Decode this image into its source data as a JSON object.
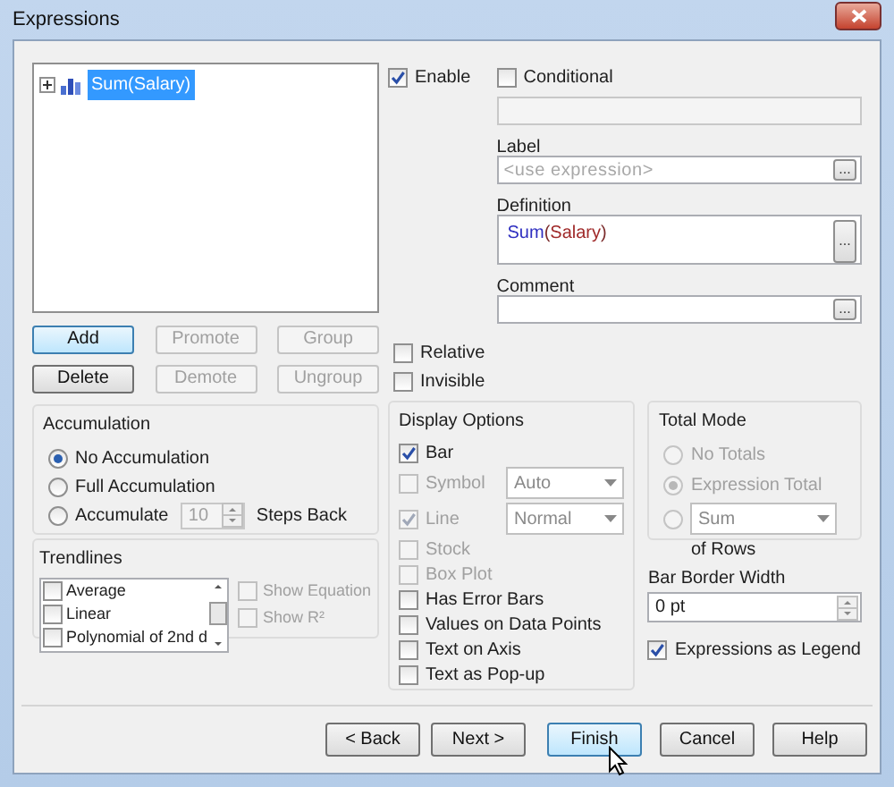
{
  "window": {
    "title": "Expressions"
  },
  "tree": [
    {
      "label": "Sum(Salary)",
      "selected": true,
      "expanded": false
    }
  ],
  "list_buttons": [
    {
      "label": "Add",
      "disabled": false,
      "focused": true
    },
    {
      "label": "Promote",
      "disabled": true,
      "focused": false
    },
    {
      "label": "Group",
      "disabled": true,
      "focused": false
    },
    {
      "label": "Delete",
      "disabled": false,
      "focused": false
    },
    {
      "label": "Demote",
      "disabled": true,
      "focused": false
    },
    {
      "label": "Ungroup",
      "disabled": true,
      "focused": false
    }
  ],
  "enable": {
    "label": "Enable",
    "checked": true
  },
  "conditional": {
    "label": "Conditional",
    "checked": false
  },
  "label_field": {
    "label": "Label",
    "placeholder": "<use expression>",
    "button": "..."
  },
  "definition": {
    "label": "Definition",
    "tokens": [
      {
        "text": "Sum",
        "kind": "function"
      },
      {
        "text": "(",
        "kind": "paren"
      },
      {
        "text": "Salary",
        "kind": "field"
      },
      {
        "text": ")",
        "kind": "paren"
      }
    ],
    "button": "..."
  },
  "comment": {
    "label": "Comment",
    "button": "..."
  },
  "flags": [
    {
      "label": "Relative",
      "checked": false
    },
    {
      "label": "Invisible",
      "checked": false
    }
  ],
  "accumulation": {
    "title": "Accumulation",
    "options": [
      {
        "label": "No Accumulation",
        "selected": true
      },
      {
        "label": "Full Accumulation",
        "selected": false
      },
      {
        "label": "Accumulate",
        "selected": false
      }
    ],
    "steps": "10",
    "steps_label": "Steps Back"
  },
  "trendlines": {
    "title": "Trendlines",
    "items": [
      {
        "label": "Average",
        "checked": false
      },
      {
        "label": "Linear",
        "checked": false
      },
      {
        "label": "Polynomial of 2nd d",
        "checked": false
      }
    ],
    "options": [
      {
        "label": "Show Equation",
        "checked": false,
        "disabled": true
      },
      {
        "label": "Show R²",
        "checked": false,
        "disabled": true
      }
    ]
  },
  "display_options": {
    "title": "Display Options",
    "items": [
      {
        "label": "Bar",
        "checked": true,
        "disabled": false
      },
      {
        "label": "Symbol",
        "checked": false,
        "disabled": true,
        "select": "Auto"
      },
      {
        "label": "Line",
        "checked": true,
        "disabled": true,
        "select": "Normal"
      },
      {
        "label": "Stock",
        "checked": false,
        "disabled": true
      },
      {
        "label": "Box Plot",
        "checked": false,
        "disabled": true
      },
      {
        "label": "Has Error Bars",
        "checked": false,
        "disabled": false
      },
      {
        "label": "Values on Data Points",
        "checked": false,
        "disabled": false
      },
      {
        "label": "Text on Axis",
        "checked": false,
        "disabled": false
      },
      {
        "label": "Text as Pop-up",
        "checked": false,
        "disabled": false
      }
    ]
  },
  "total_mode": {
    "title": "Total Mode",
    "options": [
      {
        "label": "No Totals",
        "selected": false,
        "disabled": true
      },
      {
        "label": "Expression Total",
        "selected": true,
        "disabled": true
      },
      {
        "select": "Sum",
        "selected": false,
        "disabled": true
      }
    ],
    "rows_label": "of Rows"
  },
  "bar_border_width": {
    "label": "Bar Border Width",
    "value": "0 pt"
  },
  "legend": {
    "label": "Expressions as Legend",
    "checked": true
  },
  "buttons": [
    {
      "label": "< Back",
      "focused": false
    },
    {
      "label": "Next >",
      "focused": false
    },
    {
      "label": "Finish",
      "focused": true
    },
    {
      "label": "Cancel",
      "focused": false
    },
    {
      "label": "Help",
      "focused": false
    }
  ]
}
